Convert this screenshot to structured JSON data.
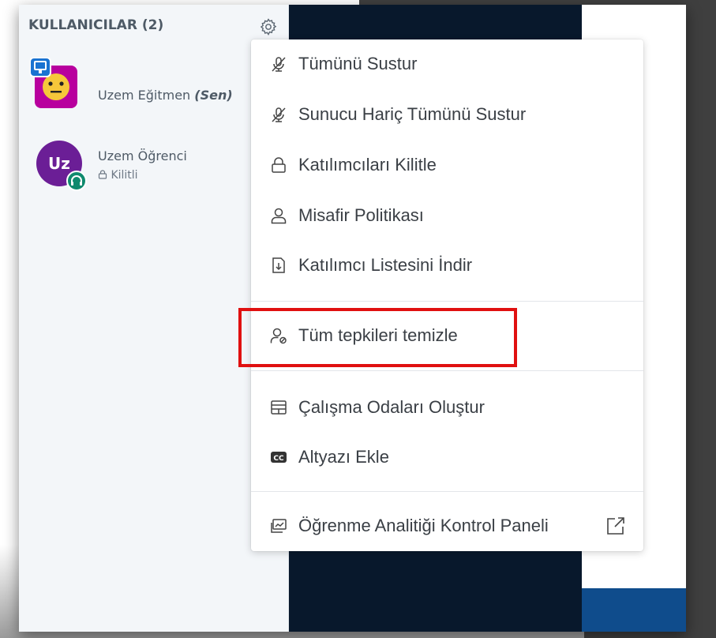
{
  "users_panel": {
    "header": "KULLANICILAR (2)",
    "users": [
      {
        "name": "Uzem Eğitmen",
        "self_tag": "(Sen)",
        "avatar_kind": "presenter"
      },
      {
        "name": "Uzem Öğrenci",
        "initials": "Uz",
        "status": "Kilitli",
        "avatar_color": "#6b1e96"
      }
    ]
  },
  "menu": {
    "items": [
      {
        "label": "Tümünü Sustur",
        "icon": "mic-off-icon"
      },
      {
        "label": "Sunucu Hariç Tümünü Sustur",
        "icon": "mic-off-icon"
      },
      {
        "label": "Katılımcıları Kilitle",
        "icon": "lock-icon"
      },
      {
        "label": "Misafir Politikası",
        "icon": "user-icon"
      },
      {
        "label": "Katılımcı Listesini İndir",
        "icon": "download-file-icon"
      },
      {
        "label": "Tüm tepkileri temizle",
        "icon": "user-clear-icon"
      },
      {
        "label": "Çalışma Odaları Oluştur",
        "icon": "rooms-icon"
      },
      {
        "label": "Altyazı Ekle",
        "icon": "cc-icon"
      },
      {
        "label": "Öğrenme Analitiği Kontrol Paneli",
        "icon": "analytics-icon"
      }
    ]
  },
  "colors": {
    "highlight": "#e01010",
    "presentation_bg": "#08182c",
    "avatar_purple": "#6b1e96"
  }
}
